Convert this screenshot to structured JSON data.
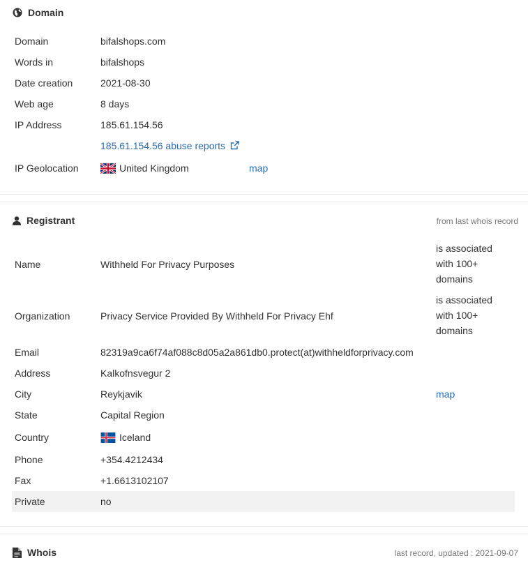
{
  "domain_section": {
    "title": "Domain",
    "rows": [
      {
        "label": "Domain",
        "value": "bifalshops.com"
      },
      {
        "label": "Words in",
        "value": "bifalshops"
      },
      {
        "label": "Date creation",
        "value": "2021-08-30"
      },
      {
        "label": "Web age",
        "value": "8 days"
      },
      {
        "label": "IP Address",
        "value": "185.61.154.56"
      },
      {
        "label": "",
        "value": "185.61.154.56 abuse reports"
      },
      {
        "label": "IP Geolocation",
        "value": "United Kingdom",
        "extra": "map"
      }
    ]
  },
  "registrant_section": {
    "title": "Registrant",
    "note": "from last whois record",
    "rows": [
      {
        "label": "Name",
        "value": "Withheld For Privacy Purposes",
        "extra": [
          "is associated",
          "with 100+",
          "domains"
        ]
      },
      {
        "label": "Organization",
        "value": "Privacy Service Provided By Withheld For Privacy Ehf",
        "extra": [
          "is associated",
          "with 100+",
          "domains"
        ]
      },
      {
        "label": "Email",
        "value": "82319a9ca6f74af088c8d05a2a861db0.protect(at)withheldforprivacy.com"
      },
      {
        "label": "Address",
        "value": "Kalkofnsvegur 2"
      },
      {
        "label": "City",
        "value": "Reykjavik",
        "extra": "map"
      },
      {
        "label": "State",
        "value": "Capital Region"
      },
      {
        "label": "Country",
        "value": "Iceland"
      },
      {
        "label": "Phone",
        "value": "+354.4212434"
      },
      {
        "label": "Fax",
        "value": "+1.6613102107"
      },
      {
        "label": "Private",
        "value": "no"
      }
    ]
  },
  "whois_section": {
    "title": "Whois",
    "note": "last record, updated : 2021-09-07"
  },
  "colors": {
    "link": "#2a6cb0",
    "text": "#333333",
    "shaded_row": "#f2f2f2"
  }
}
